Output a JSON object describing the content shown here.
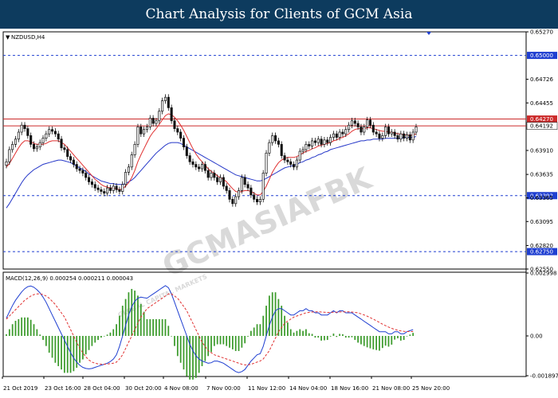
{
  "banner": {
    "title": "Chart Analysis for Clients of GCM Asia"
  },
  "watermark": {
    "main": "GCMASIAFBK",
    "sub": "GLOBAL CAPITAL MARKETS"
  },
  "chart_data": [
    {
      "type": "candlestick",
      "symbol_label": "NZDUSD,H4",
      "ylim": [
        0.6255,
        0.6527
      ],
      "y_ticks": [
        "0.65270",
        "0.64726",
        "0.64455",
        "0.63910",
        "0.63635",
        "0.63365",
        "0.63095",
        "0.62820",
        "0.62550"
      ],
      "horizontal_levels": [
        {
          "value": 0.65,
          "label": "0.65000",
          "style": "dashed",
          "color": "#1f3fd1"
        },
        {
          "value": 0.6427,
          "label": "0.64270",
          "style": "solid",
          "color": "#cc2a2a"
        },
        {
          "value": 0.64192,
          "label": "0.64192",
          "style": "solid",
          "color": "#cc2a2a",
          "current_price": true
        },
        {
          "value": 0.63392,
          "label": "0.63392",
          "style": "dashed",
          "color": "#1f3fd1"
        },
        {
          "value": 0.6275,
          "label": "0.62750",
          "style": "dashed",
          "color": "#1f3fd1"
        }
      ],
      "x_labels": [
        "21 Oct 2019",
        "23 Oct 16:00",
        "28 Oct 04:00",
        "30 Oct 20:00",
        "4 Nov 08:00",
        "7 Nov 00:00",
        "11 Nov 12:00",
        "14 Nov 04:00",
        "18 Nov 16:00",
        "21 Nov 08:00",
        "25 Nov 20:00"
      ],
      "close": [
        0.6378,
        0.6392,
        0.6398,
        0.6404,
        0.6412,
        0.642,
        0.6416,
        0.6408,
        0.6398,
        0.6393,
        0.6395,
        0.64,
        0.6405,
        0.641,
        0.6415,
        0.6413,
        0.641,
        0.6404,
        0.6394,
        0.6392,
        0.6384,
        0.638,
        0.6375,
        0.637,
        0.6368,
        0.6365,
        0.636,
        0.6355,
        0.6352,
        0.6348,
        0.6346,
        0.6344,
        0.6342,
        0.6348,
        0.6345,
        0.635,
        0.6346,
        0.6344,
        0.6352,
        0.6366,
        0.6372,
        0.6386,
        0.6398,
        0.6418,
        0.641,
        0.6415,
        0.6418,
        0.6428,
        0.6422,
        0.6425,
        0.6436,
        0.6448,
        0.6452,
        0.644,
        0.6425,
        0.6416,
        0.6412,
        0.6405,
        0.6395,
        0.6385,
        0.6378,
        0.6375,
        0.6372,
        0.637,
        0.6375,
        0.6368,
        0.636,
        0.6365,
        0.636,
        0.6355,
        0.636,
        0.635,
        0.6345,
        0.6335,
        0.633,
        0.6338,
        0.6345,
        0.636,
        0.6352,
        0.6348,
        0.634,
        0.6335,
        0.6332,
        0.6335,
        0.6365,
        0.6388,
        0.64,
        0.6408,
        0.6402,
        0.6398,
        0.6385,
        0.638,
        0.6378,
        0.6375,
        0.6372,
        0.638,
        0.639,
        0.6392,
        0.6398,
        0.6396,
        0.6402,
        0.64,
        0.6404,
        0.6398,
        0.6403,
        0.64,
        0.6406,
        0.641,
        0.6406,
        0.6412,
        0.641,
        0.6415,
        0.642,
        0.6425,
        0.6422,
        0.6418,
        0.6412,
        0.6418,
        0.6426,
        0.642,
        0.6412,
        0.641,
        0.6405,
        0.6408,
        0.6418,
        0.641,
        0.6412,
        0.6408,
        0.6404,
        0.641,
        0.6405,
        0.6409,
        0.6403,
        0.6412,
        0.6418
      ],
      "sma_red": [
        0.6372,
        0.6376,
        0.6382,
        0.6388,
        0.6394,
        0.6399,
        0.6402,
        0.6402,
        0.6401,
        0.6399,
        0.6398,
        0.6398,
        0.6398,
        0.6399,
        0.6401,
        0.6402,
        0.6402,
        0.6402,
        0.64,
        0.6398,
        0.6394,
        0.639,
        0.6386,
        0.6382,
        0.6378,
        0.6374,
        0.637,
        0.6366,
        0.6362,
        0.6358,
        0.6355,
        0.6352,
        0.635,
        0.6349,
        0.6348,
        0.6348,
        0.6347,
        0.6346,
        0.6347,
        0.635,
        0.6354,
        0.636,
        0.6368,
        0.6378,
        0.6386,
        0.6393,
        0.64,
        0.6407,
        0.6412,
        0.6416,
        0.6421,
        0.6426,
        0.6431,
        0.6433,
        0.6432,
        0.6429,
        0.6425,
        0.642,
        0.6414,
        0.6407,
        0.64,
        0.6393,
        0.6387,
        0.6382,
        0.6378,
        0.6374,
        0.637,
        0.6367,
        0.6365,
        0.6362,
        0.636,
        0.6358,
        0.6355,
        0.6351,
        0.6347,
        0.6344,
        0.6343,
        0.6344,
        0.6345,
        0.6345,
        0.6344,
        0.6342,
        0.634,
        0.634,
        0.6344,
        0.635,
        0.6358,
        0.6366,
        0.6372,
        0.6377,
        0.638,
        0.6382,
        0.6383,
        0.6383,
        0.6383,
        0.6384,
        0.6386,
        0.6388,
        0.639,
        0.6391,
        0.6393,
        0.6394,
        0.6396,
        0.6397,
        0.6398,
        0.6399,
        0.64,
        0.6402,
        0.6403,
        0.6405,
        0.6406,
        0.6408,
        0.641,
        0.6413,
        0.6415,
        0.6416,
        0.6416,
        0.6416,
        0.6417,
        0.6417,
        0.6416,
        0.6415,
        0.6414,
        0.6413,
        0.6413,
        0.6412,
        0.6412,
        0.6411,
        0.641,
        0.641,
        0.6409,
        0.6409,
        0.6408,
        0.6409,
        0.641
      ],
      "sma_blue": [
        0.6325,
        0.633,
        0.6336,
        0.6342,
        0.6348,
        0.6354,
        0.6359,
        0.6363,
        0.6366,
        0.6369,
        0.6371,
        0.6373,
        0.6375,
        0.6376,
        0.6377,
        0.6378,
        0.6379,
        0.638,
        0.638,
        0.6379,
        0.6378,
        0.6377,
        0.6375,
        0.6373,
        0.6371,
        0.6369,
        0.6367,
        0.6364,
        0.6362,
        0.636,
        0.6358,
        0.6356,
        0.6355,
        0.6354,
        0.6353,
        0.6353,
        0.6352,
        0.6352,
        0.6352,
        0.6353,
        0.6355,
        0.6357,
        0.636,
        0.6364,
        0.6368,
        0.6372,
        0.6376,
        0.638,
        0.6384,
        0.6388,
        0.6391,
        0.6394,
        0.6397,
        0.6399,
        0.64,
        0.64,
        0.64,
        0.6399,
        0.6397,
        0.6395,
        0.6393,
        0.6391,
        0.6389,
        0.6387,
        0.6385,
        0.6383,
        0.6381,
        0.6379,
        0.6377,
        0.6375,
        0.6373,
        0.6371,
        0.6369,
        0.6367,
        0.6365,
        0.6363,
        0.6362,
        0.6361,
        0.636,
        0.6359,
        0.6358,
        0.6357,
        0.6356,
        0.6356,
        0.6357,
        0.6359,
        0.6361,
        0.6363,
        0.6365,
        0.6367,
        0.6369,
        0.6371,
        0.6372,
        0.6373,
        0.6374,
        0.6375,
        0.6377,
        0.6378,
        0.638,
        0.6381,
        0.6383,
        0.6384,
        0.6386,
        0.6387,
        0.6389,
        0.639,
        0.6392,
        0.6393,
        0.6394,
        0.6395,
        0.6396,
        0.6397,
        0.6398,
        0.6399,
        0.64,
        0.6401,
        0.6402,
        0.6402,
        0.6403,
        0.6403,
        0.6404,
        0.6404,
        0.6404,
        0.6404,
        0.6405,
        0.6405,
        0.6405,
        0.6405,
        0.6405,
        0.6405,
        0.6406,
        0.6406,
        0.6406,
        0.6406,
        0.6407
      ],
      "colors": {
        "sma_red": "#e03030",
        "sma_blue": "#2436c8",
        "candle": "#111111",
        "grid_level_dashed": "#1f3fd1",
        "grid_level_solid": "#cc2a2a",
        "tag_bg": "#1f3fd1",
        "tag_bg_red": "#cc2a2a"
      }
    },
    {
      "type": "macd",
      "label": "MACD(12,26,9) 0.000254 0.000211 0.000043",
      "ylim": [
        -0.001897,
        0.002998
      ],
      "y_ticks": [
        "0.002998",
        "0.00",
        "-0.001897"
      ],
      "macd_values": [
        0.00085,
        0.00115,
        0.00145,
        0.0017,
        0.0019,
        0.0021,
        0.00225,
        0.00235,
        0.00238,
        0.00232,
        0.0022,
        0.00205,
        0.00185,
        0.0016,
        0.0013,
        0.001,
        0.0007,
        0.0004,
        0.0001,
        -0.0002,
        -0.0005,
        -0.0008,
        -0.00105,
        -0.00125,
        -0.0014,
        -0.0015,
        -0.00155,
        -0.00157,
        -0.00155,
        -0.0015,
        -0.00145,
        -0.0014,
        -0.00135,
        -0.0013,
        -0.00122,
        -0.0011,
        -0.0009,
        -0.0005,
        0.0,
        0.0005,
        0.001,
        0.0014,
        0.00165,
        0.0018,
        0.00185,
        0.00182,
        0.0018,
        0.0019,
        0.002,
        0.0021,
        0.0022,
        0.0023,
        0.0024,
        0.0023,
        0.002,
        0.0016,
        0.0012,
        0.0008,
        0.0004,
        0.0,
        -0.0004,
        -0.0007,
        -0.00095,
        -0.0011,
        -0.0012,
        -0.00125,
        -0.0013,
        -0.00128,
        -0.0012,
        -0.0012,
        -0.00125,
        -0.0013,
        -0.0014,
        -0.0015,
        -0.0016,
        -0.0017,
        -0.00175,
        -0.0017,
        -0.0016,
        -0.0014,
        -0.0012,
        -0.00105,
        -0.0009,
        -0.00085,
        -0.0005,
        0.0,
        0.0005,
        0.0009,
        0.0012,
        0.0013,
        0.0013,
        0.0012,
        0.0011,
        0.001,
        0.001,
        0.0011,
        0.0012,
        0.0012,
        0.0013,
        0.0012,
        0.0012,
        0.0011,
        0.0011,
        0.001,
        0.001,
        0.001,
        0.0011,
        0.0012,
        0.0011,
        0.0012,
        0.0012,
        0.0011,
        0.0011,
        0.0011,
        0.001,
        0.0009,
        0.0008,
        0.0007,
        0.0006,
        0.0005,
        0.0004,
        0.0003,
        0.0002,
        0.0002,
        0.0002,
        0.0001,
        0.0001,
        0.0002,
        0.0002,
        0.0001,
        0.0001,
        0.0002,
        0.00025,
        0.0003
      ],
      "signal_values": [
        0.0008,
        0.00095,
        0.0011,
        0.00125,
        0.0014,
        0.00155,
        0.0017,
        0.0018,
        0.0019,
        0.00197,
        0.002,
        0.00201,
        0.00197,
        0.0019,
        0.0018,
        0.00165,
        0.0015,
        0.0013,
        0.0011,
        0.0009,
        0.0006,
        0.0003,
        0.0,
        -0.0003,
        -0.0006,
        -0.0008,
        -0.001,
        -0.00115,
        -0.00125,
        -0.0013,
        -0.00133,
        -0.00135,
        -0.00135,
        -0.00134,
        -0.00132,
        -0.0013,
        -0.00125,
        -0.0011,
        -0.0009,
        -0.0006,
        -0.0003,
        0.0,
        0.0003,
        0.0006,
        0.0009,
        0.0011,
        0.0013,
        0.0014,
        0.0015,
        0.0016,
        0.0017,
        0.0018,
        0.0019,
        0.002,
        0.002,
        0.0019,
        0.0018,
        0.0016,
        0.0014,
        0.0012,
        0.0009,
        0.0006,
        0.0003,
        0.0,
        -0.0003,
        -0.0005,
        -0.0007,
        -0.0008,
        -0.0009,
        -0.00095,
        -0.001,
        -0.00105,
        -0.0011,
        -0.00115,
        -0.0012,
        -0.00125,
        -0.0013,
        -0.00135,
        -0.00138,
        -0.00138,
        -0.00135,
        -0.0013,
        -0.00125,
        -0.0012,
        -0.0011,
        -0.0009,
        -0.0007,
        -0.0004,
        -0.0001,
        0.0002,
        0.0004,
        0.0006,
        0.0007,
        0.0008,
        0.0009,
        0.00095,
        0.001,
        0.00105,
        0.0011,
        0.00112,
        0.00114,
        0.00115,
        0.00115,
        0.00114,
        0.00113,
        0.00112,
        0.00112,
        0.00113,
        0.00113,
        0.00114,
        0.00115,
        0.00115,
        0.00115,
        0.00114,
        0.00112,
        0.0011,
        0.00105,
        0.001,
        0.00094,
        0.00087,
        0.0008,
        0.00072,
        0.00064,
        0.00056,
        0.00049,
        0.00042,
        0.00036,
        0.00031,
        0.00027,
        0.00024,
        0.00022,
        0.00021,
        0.00021,
        0.00021
      ],
      "colors": {
        "macd": "#1f3fd1",
        "signal": "#e03030",
        "histogram": "#3a9a2a"
      }
    }
  ]
}
